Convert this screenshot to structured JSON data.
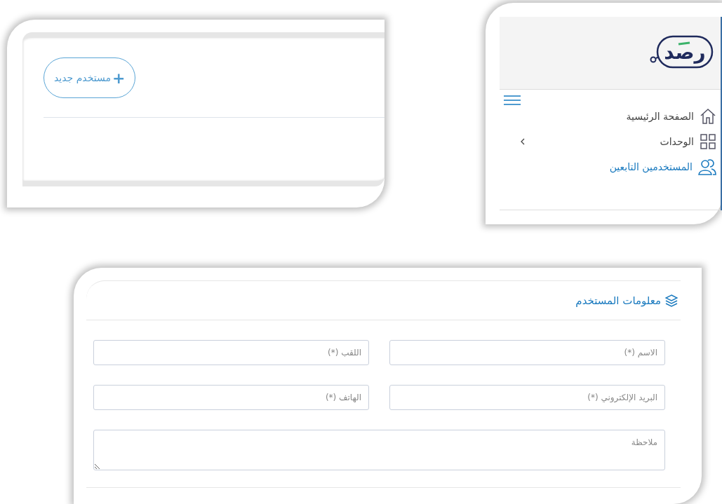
{
  "toolbar": {
    "new_user_button": {
      "icon": "+",
      "label": "مستخدم جديد"
    }
  },
  "sidebar": {
    "logo_text": "رصد",
    "items": [
      {
        "kind": "home",
        "label": "الصفحة الرئيسية",
        "selected": false
      },
      {
        "kind": "grid",
        "label": "الوحدات",
        "selected": false,
        "expanded": false
      },
      {
        "kind": "users",
        "label": "المستخدمين التابعين",
        "selected": true
      }
    ]
  },
  "form": {
    "title": "معلومات المستخدم",
    "fields": [
      {
        "kind": "input",
        "placeholder": "الاسم (*)"
      },
      {
        "kind": "input",
        "placeholder": "اللقب (*)"
      },
      {
        "kind": "input",
        "placeholder": "البريد الإلكتروني (*)"
      },
      {
        "kind": "input",
        "placeholder": "الهاتف (*)"
      },
      {
        "kind": "textarea",
        "placeholder": "ملاحظة"
      }
    ]
  }
}
